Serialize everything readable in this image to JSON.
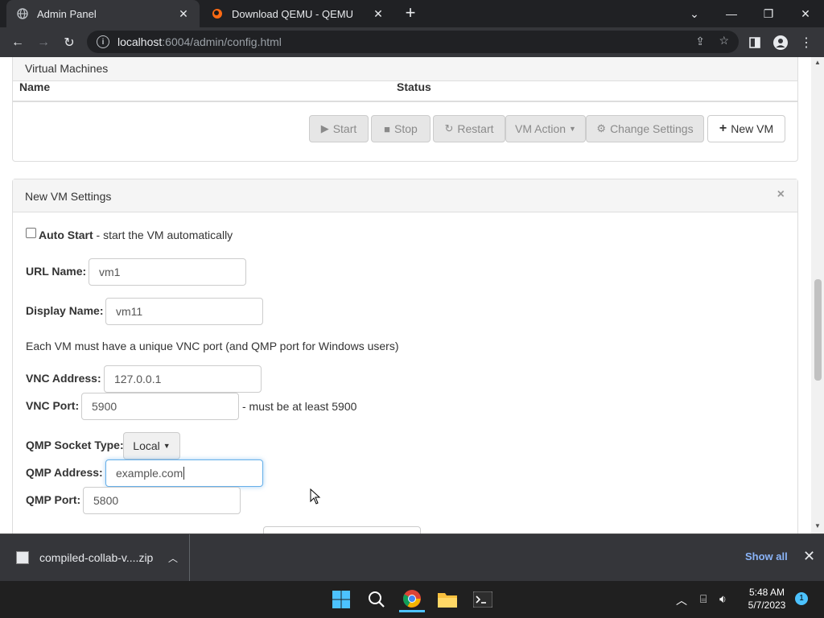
{
  "browser": {
    "tabs": [
      {
        "title": "Admin Panel",
        "active": true
      },
      {
        "title": "Download QEMU - QEMU",
        "active": false
      }
    ],
    "url_host": "localhost",
    "url_rest": ":6004/admin/config.html"
  },
  "vm_panel": {
    "heading": "Virtual Machines",
    "col_name": "Name",
    "col_status": "Status",
    "buttons": {
      "start": "Start",
      "stop": "Stop",
      "restart": "Restart",
      "vm_action": "VM Action",
      "change_settings": "Change Settings",
      "new_vm": "New VM"
    }
  },
  "settings": {
    "heading": "New VM Settings",
    "close": "×",
    "auto_start_label": "Auto Start",
    "auto_start_desc": " - start the VM automatically",
    "auto_start_checked": false,
    "url_name_label": "URL Name:",
    "url_name_value": "vm1",
    "display_name_label": "Display Name:",
    "display_name_value": "vm11",
    "vnc_note": "Each VM must have a unique VNC port (and QMP port for Windows users)",
    "vnc_address_label": "VNC Address:",
    "vnc_address_value": "127.0.0.1",
    "vnc_port_label": "VNC Port:",
    "vnc_port_value": "5900",
    "vnc_port_hint": "- must be at least 5900",
    "qmp_socket_label": "QMP Socket Type:",
    "qmp_socket_value": "Local",
    "qmp_address_label": "QMP Address:",
    "qmp_address_value": "example.com",
    "qmp_port_label": "QMP Port:",
    "qmp_port_value": "5800"
  },
  "download_bar": {
    "filename": "compiled-collab-v....zip",
    "show_all": "Show all"
  },
  "taskbar": {
    "time": "5:48 AM",
    "date": "5/7/2023",
    "notifications": "1"
  },
  "colors": {
    "accent_focus": "#66afe9",
    "chrome_dark": "#202124",
    "link_blue": "#8ab4f8"
  }
}
